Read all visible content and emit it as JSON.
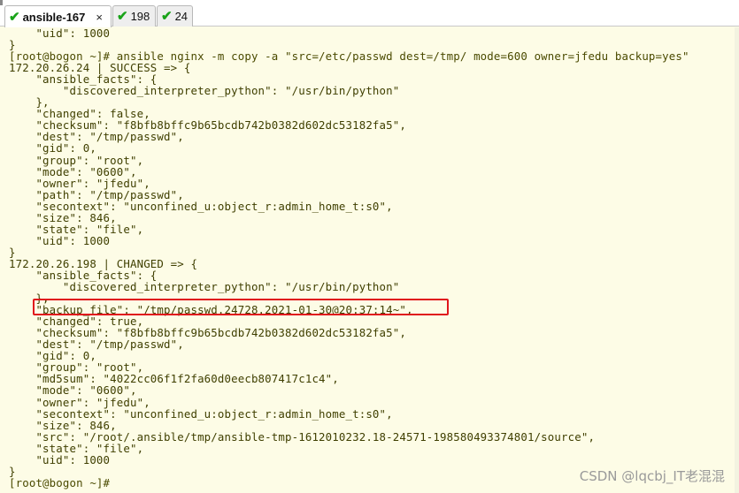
{
  "tabs": [
    {
      "label": "ansible-167",
      "status": "check-icon",
      "active": true,
      "close": "×"
    },
    {
      "label": "198",
      "status": "check-icon",
      "active": false
    },
    {
      "label": "24",
      "status": "check-icon",
      "active": false
    }
  ],
  "terminal": {
    "lines": [
      "    \"uid\": 1000",
      "}",
      "[root@bogon ~]# ansible nginx -m copy -a \"src=/etc/passwd dest=/tmp/ mode=600 owner=jfedu backup=yes\"",
      "172.20.26.24 | SUCCESS => {",
      "    \"ansible_facts\": {",
      "        \"discovered_interpreter_python\": \"/usr/bin/python\"",
      "    },",
      "    \"changed\": false,",
      "    \"checksum\": \"f8bfb8bffc9b65bcdb742b0382d602dc53182fa5\",",
      "    \"dest\": \"/tmp/passwd\",",
      "    \"gid\": 0,",
      "    \"group\": \"root\",",
      "    \"mode\": \"0600\",",
      "    \"owner\": \"jfedu\",",
      "    \"path\": \"/tmp/passwd\",",
      "    \"secontext\": \"unconfined_u:object_r:admin_home_t:s0\",",
      "    \"size\": 846,",
      "    \"state\": \"file\",",
      "    \"uid\": 1000",
      "}",
      "172.20.26.198 | CHANGED => {",
      "    \"ansible_facts\": {",
      "        \"discovered_interpreter_python\": \"/usr/bin/python\"",
      "    },",
      "    \"backup_file\": \"/tmp/passwd.24728.2021-01-30@20:37:14~\",",
      "    \"changed\": true,",
      "    \"checksum\": \"f8bfb8bffc9b65bcdb742b0382d602dc53182fa5\",",
      "    \"dest\": \"/tmp/passwd\",",
      "    \"gid\": 0,",
      "    \"group\": \"root\",",
      "    \"md5sum\": \"4022cc06f1f2fa60d0eecb807417c1c4\",",
      "    \"mode\": \"0600\",",
      "    \"owner\": \"jfedu\",",
      "    \"secontext\": \"unconfined_u:object_r:admin_home_t:s0\",",
      "    \"size\": 846,",
      "    \"src\": \"/root/.ansible/tmp/ansible-tmp-1612010232.18-24571-198580493374801/source\",",
      "    \"state\": \"file\",",
      "    \"uid\": 1000",
      "}",
      "[root@bogon ~]#"
    ]
  },
  "watermark": "CSDN @lqcbj_IT老混混",
  "colors": {
    "terminal_bg": "#fdfce6",
    "terminal_fg": "#3f3f00",
    "highlight": "#e0161c",
    "tab_check": "#19a319"
  }
}
